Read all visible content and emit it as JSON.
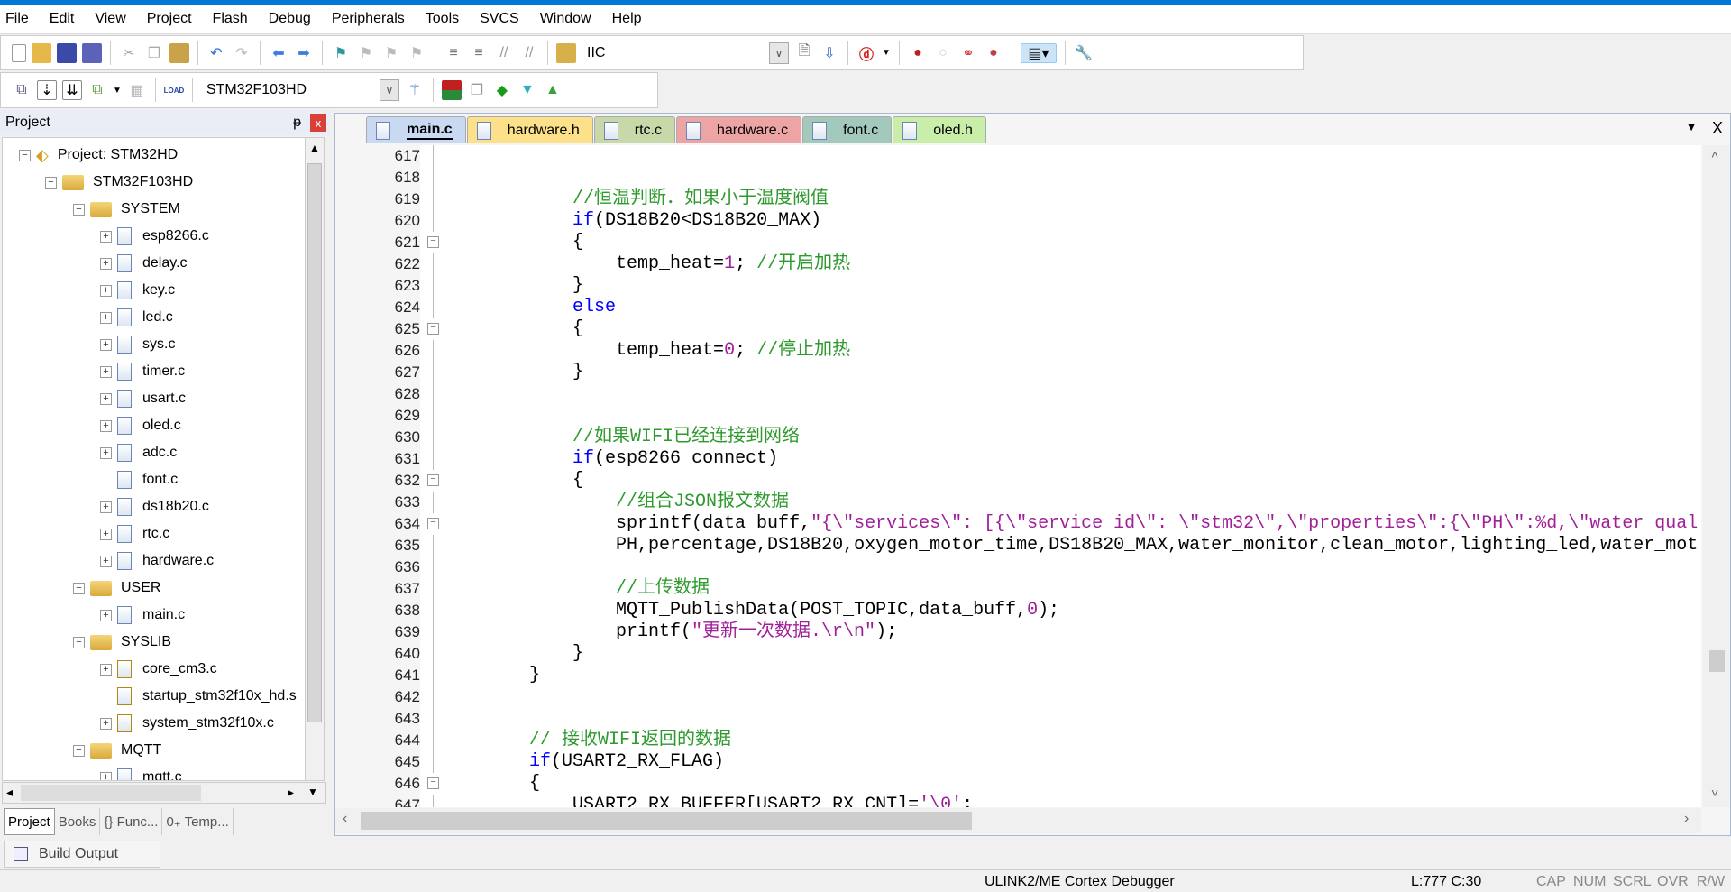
{
  "menu": [
    "File",
    "Edit",
    "View",
    "Project",
    "Flash",
    "Debug",
    "Peripherals",
    "Tools",
    "SVCS",
    "Window",
    "Help"
  ],
  "toolbar1": {
    "find_combo_value": "IIC"
  },
  "toolbar2": {
    "target_combo_value": "STM32F103HD",
    "load_label": "LOAD"
  },
  "project_panel": {
    "title": "Project",
    "pin": "ᵽ",
    "close": "x",
    "tree": [
      {
        "label": "Project: STM32HD",
        "level": 0,
        "type": "project",
        "expander": "−"
      },
      {
        "label": "STM32F103HD",
        "level": 1,
        "type": "target",
        "expander": "−"
      },
      {
        "label": "SYSTEM",
        "level": 2,
        "type": "folder",
        "expander": "−"
      },
      {
        "label": "esp8266.c",
        "level": 3,
        "type": "file",
        "expander": "+"
      },
      {
        "label": "delay.c",
        "level": 3,
        "type": "file",
        "expander": "+"
      },
      {
        "label": "key.c",
        "level": 3,
        "type": "file",
        "expander": "+"
      },
      {
        "label": "led.c",
        "level": 3,
        "type": "file",
        "expander": "+"
      },
      {
        "label": "sys.c",
        "level": 3,
        "type": "file",
        "expander": "+"
      },
      {
        "label": "timer.c",
        "level": 3,
        "type": "file",
        "expander": "+"
      },
      {
        "label": "usart.c",
        "level": 3,
        "type": "file",
        "expander": "+"
      },
      {
        "label": "oled.c",
        "level": 3,
        "type": "file",
        "expander": "+"
      },
      {
        "label": "adc.c",
        "level": 3,
        "type": "file",
        "expander": "+"
      },
      {
        "label": "font.c",
        "level": 3,
        "type": "file",
        "expander": ""
      },
      {
        "label": "ds18b20.c",
        "level": 3,
        "type": "file",
        "expander": "+"
      },
      {
        "label": "rtc.c",
        "level": 3,
        "type": "file",
        "expander": "+"
      },
      {
        "label": "hardware.c",
        "level": 3,
        "type": "file",
        "expander": "+"
      },
      {
        "label": "USER",
        "level": 2,
        "type": "folder",
        "expander": "−"
      },
      {
        "label": "main.c",
        "level": 3,
        "type": "file",
        "expander": "+"
      },
      {
        "label": "SYSLIB",
        "level": 2,
        "type": "folder",
        "expander": "−"
      },
      {
        "label": "core_cm3.c",
        "level": 3,
        "type": "keyfile",
        "expander": "+"
      },
      {
        "label": "startup_stm32f10x_hd.s",
        "level": 3,
        "type": "keyfile",
        "expander": ""
      },
      {
        "label": "system_stm32f10x.c",
        "level": 3,
        "type": "keyfile",
        "expander": "+"
      },
      {
        "label": "MQTT",
        "level": 2,
        "type": "folder",
        "expander": "−"
      },
      {
        "label": "mqtt.c",
        "level": 3,
        "type": "file",
        "expander": "+"
      }
    ],
    "tabs": [
      {
        "label": "Project",
        "active": true
      },
      {
        "label": "Books"
      },
      {
        "label": "{} Func..."
      },
      {
        "label": "0₊ Temp..."
      }
    ]
  },
  "editor": {
    "tabs": [
      {
        "label": "main.c",
        "color": "#c9d9f2",
        "active": true
      },
      {
        "label": "hardware.h",
        "color": "#fde08a"
      },
      {
        "label": "rtc.c",
        "color": "#c8d8a8"
      },
      {
        "label": "hardware.c",
        "color": "#eca4a4"
      },
      {
        "label": "font.c",
        "color": "#a3c9bc"
      },
      {
        "label": "oled.h",
        "color": "#c8eeaa"
      }
    ],
    "tab_menu": "▼",
    "tab_close": "X",
    "lines": [
      {
        "n": "617",
        "fold": "line",
        "seg": []
      },
      {
        "n": "618",
        "fold": "line",
        "seg": []
      },
      {
        "n": "619",
        "fold": "line",
        "seg": [
          [
            "",
            "            "
          ],
          [
            "cm",
            "//恒温判断．如果小于温度阀值"
          ]
        ]
      },
      {
        "n": "620",
        "fold": "line",
        "seg": [
          [
            "",
            "            "
          ],
          [
            "kw",
            "if"
          ],
          [
            "",
            "(DS18B20<DS18B20_MAX)"
          ]
        ]
      },
      {
        "n": "621",
        "fold": "box",
        "seg": [
          [
            "",
            "            {"
          ]
        ]
      },
      {
        "n": "622",
        "fold": "line",
        "seg": [
          [
            "",
            "                temp_heat="
          ],
          [
            "num",
            "1"
          ],
          [
            "",
            "; "
          ],
          [
            "cm",
            "//开启加热"
          ]
        ]
      },
      {
        "n": "623",
        "fold": "line",
        "seg": [
          [
            "",
            "            }"
          ]
        ]
      },
      {
        "n": "624",
        "fold": "line",
        "seg": [
          [
            "",
            "            "
          ],
          [
            "kw",
            "else"
          ]
        ]
      },
      {
        "n": "625",
        "fold": "box",
        "seg": [
          [
            "",
            "            {"
          ]
        ]
      },
      {
        "n": "626",
        "fold": "line",
        "seg": [
          [
            "",
            "                temp_heat="
          ],
          [
            "num",
            "0"
          ],
          [
            "",
            "; "
          ],
          [
            "cm",
            "//停止加热"
          ]
        ]
      },
      {
        "n": "627",
        "fold": "line",
        "seg": [
          [
            "",
            "            }"
          ]
        ]
      },
      {
        "n": "628",
        "fold": "line",
        "seg": []
      },
      {
        "n": "629",
        "fold": "line",
        "seg": []
      },
      {
        "n": "630",
        "fold": "line",
        "seg": [
          [
            "",
            "            "
          ],
          [
            "cm",
            "//如果WIFI已经连接到网络"
          ]
        ]
      },
      {
        "n": "631",
        "fold": "line",
        "seg": [
          [
            "",
            "            "
          ],
          [
            "kw",
            "if"
          ],
          [
            "",
            "(esp8266_connect)"
          ]
        ]
      },
      {
        "n": "632",
        "fold": "box",
        "seg": [
          [
            "",
            "            {"
          ]
        ]
      },
      {
        "n": "633",
        "fold": "line",
        "seg": [
          [
            "",
            "                "
          ],
          [
            "cm",
            "//组合JSON报文数据"
          ]
        ]
      },
      {
        "n": "634",
        "fold": "box",
        "seg": [
          [
            "",
            "                sprintf(data_buff,"
          ],
          [
            "st",
            "\"{\\\"services\\\": [{\\\"service_id\\\": \\\"stm32\\\",\\\"properties\\\":{\\\"PH\\\":%d,\\\"water_qual"
          ]
        ]
      },
      {
        "n": "635",
        "fold": "line",
        "seg": [
          [
            "",
            "                PH,percentage,DS18B20,oxygen_motor_time,DS18B20_MAX,water_monitor,clean_motor,lighting_led,water_mot"
          ]
        ]
      },
      {
        "n": "636",
        "fold": "line",
        "seg": []
      },
      {
        "n": "637",
        "fold": "line",
        "seg": [
          [
            "",
            "                "
          ],
          [
            "cm",
            "//上传数据"
          ]
        ]
      },
      {
        "n": "638",
        "fold": "line",
        "seg": [
          [
            "",
            "                MQTT_PublishData(POST_TOPIC,data_buff,"
          ],
          [
            "num",
            "0"
          ],
          [
            "",
            ");"
          ]
        ]
      },
      {
        "n": "639",
        "fold": "line",
        "seg": [
          [
            "",
            "                printf("
          ],
          [
            "st",
            "\"更新一次数据.\\r\\n\""
          ],
          [
            "",
            ");"
          ]
        ]
      },
      {
        "n": "640",
        "fold": "line",
        "seg": [
          [
            "",
            "            }"
          ]
        ]
      },
      {
        "n": "641",
        "fold": "line",
        "seg": [
          [
            "",
            "        }"
          ]
        ]
      },
      {
        "n": "642",
        "fold": "line",
        "seg": []
      },
      {
        "n": "643",
        "fold": "line",
        "seg": []
      },
      {
        "n": "644",
        "fold": "line",
        "seg": [
          [
            "",
            "        "
          ],
          [
            "cm",
            "// 接收WIFI返回的数据"
          ]
        ]
      },
      {
        "n": "645",
        "fold": "line",
        "seg": [
          [
            "",
            "        "
          ],
          [
            "kw",
            "if"
          ],
          [
            "",
            "(USART2_RX_FLAG)"
          ]
        ]
      },
      {
        "n": "646",
        "fold": "box",
        "seg": [
          [
            "",
            "        {"
          ]
        ]
      },
      {
        "n": "647",
        "fold": "line",
        "seg": [
          [
            "",
            "            USART2_RX_BUFFER[USART2_RX_CNT]="
          ],
          [
            "st",
            "'\\0'"
          ],
          [
            "",
            ";"
          ]
        ]
      }
    ]
  },
  "build_output": {
    "label": "Build Output"
  },
  "status": {
    "debugger": "ULINK2/ME Cortex Debugger",
    "position": "L:777 C:30",
    "cap": "CAP",
    "num": "NUM",
    "scrl": "SCRL",
    "ovr": "OVR",
    "rw": "R/W"
  }
}
